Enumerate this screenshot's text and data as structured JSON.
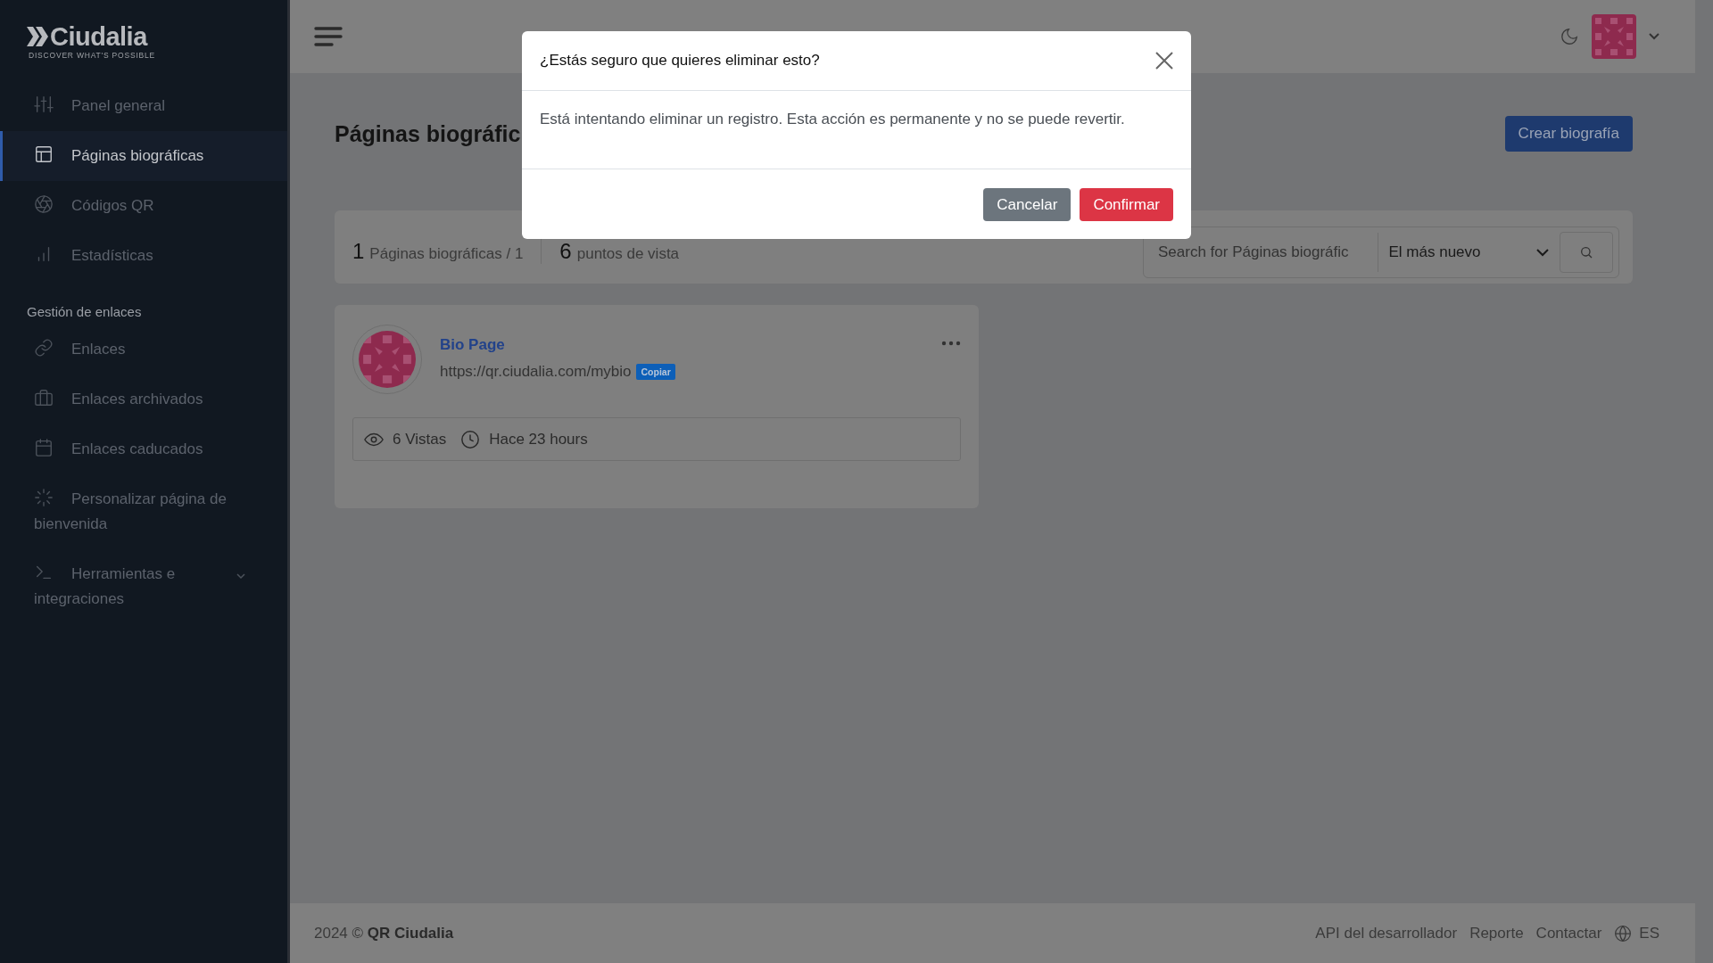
{
  "sidebar": {
    "logo": {
      "name": "Ciudalia",
      "tagline": "DISCOVER WHAT'S POSSIBLE"
    },
    "groups": [
      {
        "items": [
          {
            "label": "Panel general",
            "selected": false
          },
          {
            "label": "Páginas biográficas",
            "selected": true
          },
          {
            "label": "Códigos QR",
            "selected": false
          },
          {
            "label": "Estadísticas",
            "selected": false
          }
        ]
      },
      {
        "title": "Gestión de enlaces",
        "items": [
          {
            "label": "Enlaces",
            "selected": false
          },
          {
            "label": "Enlaces archivados",
            "selected": false
          },
          {
            "label": "Enlaces caducados",
            "selected": false
          },
          {
            "label": "Personalizar página de bienvenida",
            "selected": false
          },
          {
            "label": "Herramientas e integraciones",
            "selected": false,
            "expanded": false
          }
        ]
      }
    ]
  },
  "page": {
    "title": "Páginas biográfic",
    "create_button": "Crear biografía",
    "stats": [
      {
        "count": "1",
        "label": "Páginas biográficas / 1"
      },
      {
        "count": "6",
        "label": "puntos de vista"
      }
    ],
    "search": {
      "placeholder": "Search for Páginas biográfic"
    },
    "sort": {
      "value": "El más nuevo"
    },
    "cards": [
      {
        "title": "Bio Page",
        "url": "https://qr.ciudalia.com/mybio",
        "copy_label": "Copiar",
        "views": "6 Vistas",
        "time": "Hace 23 hours"
      }
    ]
  },
  "footer": {
    "copyright": "2024 © **QR Ciudalia**",
    "links": [
      "API del desarrollador",
      "Reporte",
      "Contactar"
    ],
    "language": "ES"
  },
  "modal": {
    "title": "¿Estás seguro que quieres eliminar esto?",
    "message": "Está intentando eliminar un registro. Esta acción es permanente y no se puede revertir.",
    "buttons": [
      {
        "label": "Cancelar",
        "kind": "secondary"
      },
      {
        "label": "Confirmar",
        "kind": "danger"
      }
    ]
  }
}
